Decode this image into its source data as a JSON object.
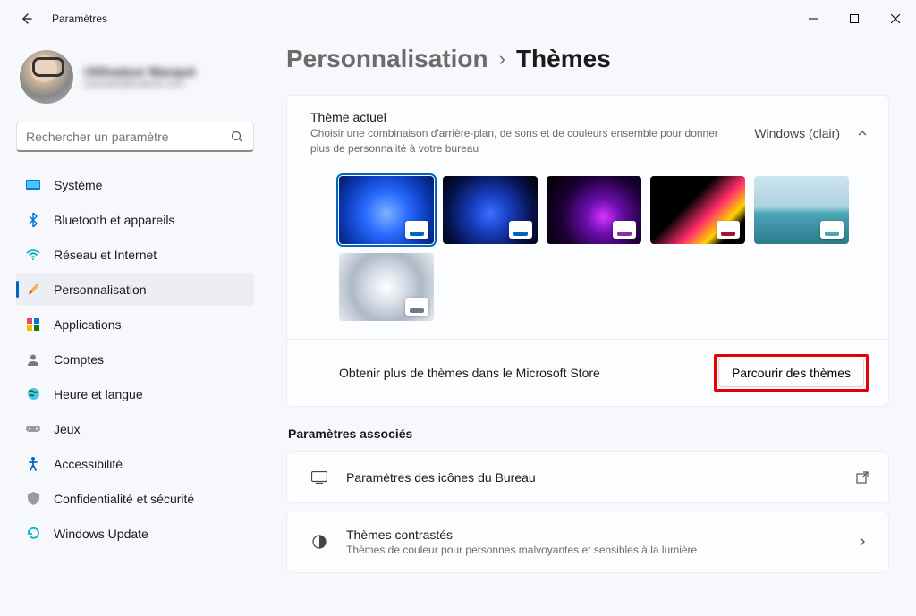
{
  "window": {
    "title": "Paramètres"
  },
  "profile": {
    "name": "Utilisateur Masqué",
    "email": "exemple@outlook.com"
  },
  "search": {
    "placeholder": "Rechercher un paramètre"
  },
  "nav": {
    "system": "Système",
    "bluetooth": "Bluetooth et appareils",
    "network": "Réseau et Internet",
    "personalization": "Personnalisation",
    "apps": "Applications",
    "accounts": "Comptes",
    "time": "Heure et langue",
    "gaming": "Jeux",
    "accessibility": "Accessibilité",
    "privacy": "Confidentialité et sécurité",
    "update": "Windows Update"
  },
  "breadcrumb": {
    "parent": "Personnalisation",
    "current": "Thèmes"
  },
  "themeCard": {
    "title": "Thème actuel",
    "subtitle": "Choisir une combinaison d'arrière-plan, de sons et de couleurs ensemble pour donner plus de personnalité à votre bureau",
    "value": "Windows (clair)",
    "footerText": "Obtenir plus de thèmes dans le Microsoft Store",
    "browseBtn": "Parcourir des thèmes"
  },
  "themes": [
    {
      "bg": "bg-bloom-light",
      "accent": "#0067c0",
      "selected": true
    },
    {
      "bg": "bg-bloom-dark",
      "accent": "#0067c0",
      "selected": false
    },
    {
      "bg": "bg-glow",
      "accent": "#8a2da8",
      "selected": false
    },
    {
      "bg": "bg-flow",
      "accent": "#b01030",
      "selected": false
    },
    {
      "bg": "bg-sunrise",
      "accent": "#4aa6b8",
      "selected": false
    },
    {
      "bg": "bg-motion",
      "accent": "#6b7a88",
      "selected": false
    }
  ],
  "related": {
    "heading": "Paramètres associés",
    "desktopIcons": "Paramètres des icônes du Bureau",
    "contrast": {
      "title": "Thèmes contrastés",
      "sub": "Thèmes de couleur pour personnes malvoyantes et sensibles à la lumière"
    }
  }
}
